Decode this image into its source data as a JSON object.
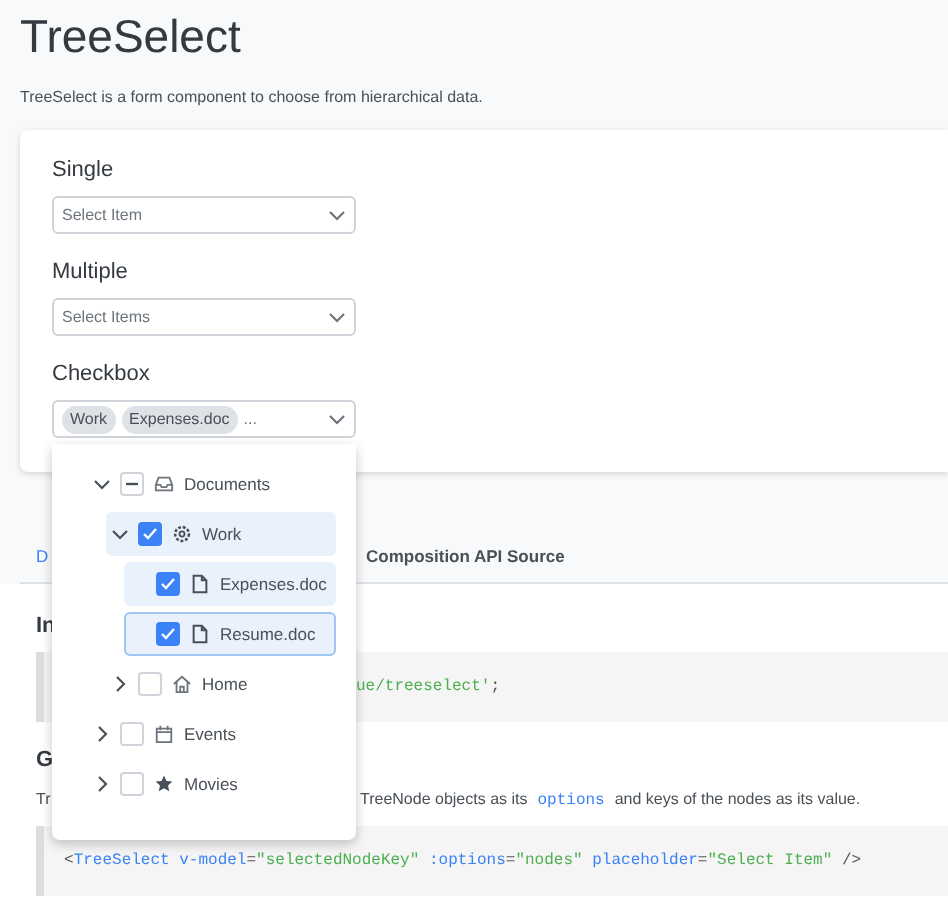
{
  "header": {
    "title": "TreeSelect",
    "description": "TreeSelect is a form component to choose from hierarchical data."
  },
  "fields": [
    {
      "label": "Single",
      "kind": "placeholder",
      "placeholder": "Select Item"
    },
    {
      "label": "Multiple",
      "kind": "placeholder",
      "placeholder": "Select Items"
    },
    {
      "label": "Checkbox",
      "kind": "chips",
      "chips": [
        "Work",
        "Expenses.doc"
      ],
      "more": "..."
    }
  ],
  "tree": [
    {
      "label": "Documents",
      "kind": "inbox",
      "expanded": true,
      "checked": false,
      "indeterminate": true,
      "highlighted": false,
      "focused": false,
      "children": [
        {
          "label": "Work",
          "kind": "gear",
          "expanded": true,
          "checked": true,
          "highlighted": true,
          "focused": false,
          "children": [
            {
              "label": "Expenses.doc",
              "kind": "file",
              "checked": true,
              "highlighted": true,
              "focused": false
            },
            {
              "label": "Resume.doc",
              "kind": "file",
              "checked": true,
              "highlighted": true,
              "focused": true
            }
          ]
        },
        {
          "label": "Home",
          "kind": "home",
          "expanded": false,
          "checked": false,
          "highlighted": false,
          "focused": false
        }
      ]
    },
    {
      "label": "Events",
      "kind": "calendar",
      "expanded": false,
      "checked": false,
      "highlighted": false,
      "focused": false
    },
    {
      "label": "Movies",
      "kind": "star",
      "expanded": false,
      "checked": false,
      "highlighted": false,
      "focused": false
    }
  ],
  "tabs": [
    {
      "label": "D",
      "selected": true
    },
    {
      "label": "Composition API Source",
      "selected": false
    }
  ],
  "sections": [
    {
      "heading": "In",
      "code": [
        {
          "kind": "string",
          "text": "ue/treeselect'"
        },
        {
          "kind": "punct",
          "text": ";"
        }
      ]
    },
    {
      "heading": "G",
      "text_start": "Tr",
      "text": [
        {
          "kind": "plain",
          "text": "TreeNode objects as its"
        },
        {
          "kind": "code",
          "text": "options"
        },
        {
          "kind": "plain",
          "text": "and keys of the nodes as its value."
        }
      ],
      "code": [
        {
          "kind": "punct",
          "text": "<"
        },
        {
          "kind": "tag",
          "text": "TreeSelect"
        },
        {
          "kind": "attr",
          "text": " v-model"
        },
        {
          "kind": "punct",
          "text": "="
        },
        {
          "kind": "string",
          "text": "\"selectedNodeKey\""
        },
        {
          "kind": "attr",
          "text": " :options"
        },
        {
          "kind": "punct",
          "text": "="
        },
        {
          "kind": "string",
          "text": "\"nodes\""
        },
        {
          "kind": "attr",
          "text": " placeholder"
        },
        {
          "kind": "punct",
          "text": "="
        },
        {
          "kind": "string",
          "text": "\"Select Item\""
        },
        {
          "kind": "punct",
          "text": " />"
        }
      ]
    }
  ]
}
